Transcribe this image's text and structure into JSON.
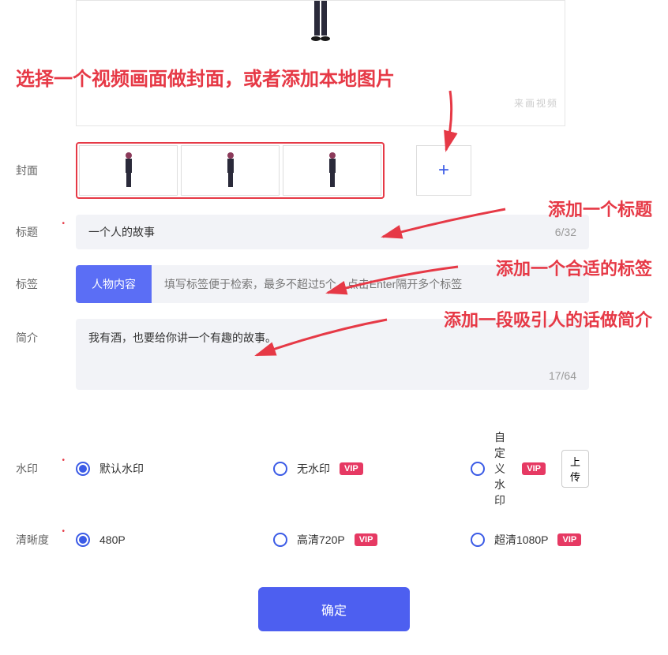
{
  "preview": {
    "watermark_text": "来画视频"
  },
  "annotations": {
    "cover": "选择一个视频画面做封面，或者添加本地图片",
    "title": "添加一个标题",
    "tag": "添加一个合适的标签",
    "intro": "添加一段吸引人的话做简介"
  },
  "labels": {
    "cover": "封面",
    "title": "标题",
    "tag": "标签",
    "intro": "简介",
    "watermark": "水印",
    "quality": "清晰度"
  },
  "title_input": {
    "value": "一个人的故事",
    "count": "6/32"
  },
  "tag_input": {
    "chip": "人物内容",
    "placeholder": "填写标签便于检索，最多不超过5个，点击Enter隔开多个标签"
  },
  "intro_input": {
    "value": "我有酒，也要给你讲一个有趣的故事。",
    "count": "17/64"
  },
  "watermark": {
    "opt1": "默认水印",
    "opt2": "无水印",
    "opt3": "自定义水印",
    "vip": "VIP",
    "upload": "上传"
  },
  "quality": {
    "opt1": "480P",
    "opt2": "高清720P",
    "opt3": "超清1080P",
    "vip": "VIP"
  },
  "submit": "确定",
  "colors": {
    "primary": "#4d5ff0",
    "annotation": "#e63946",
    "vip": "#e63963"
  }
}
